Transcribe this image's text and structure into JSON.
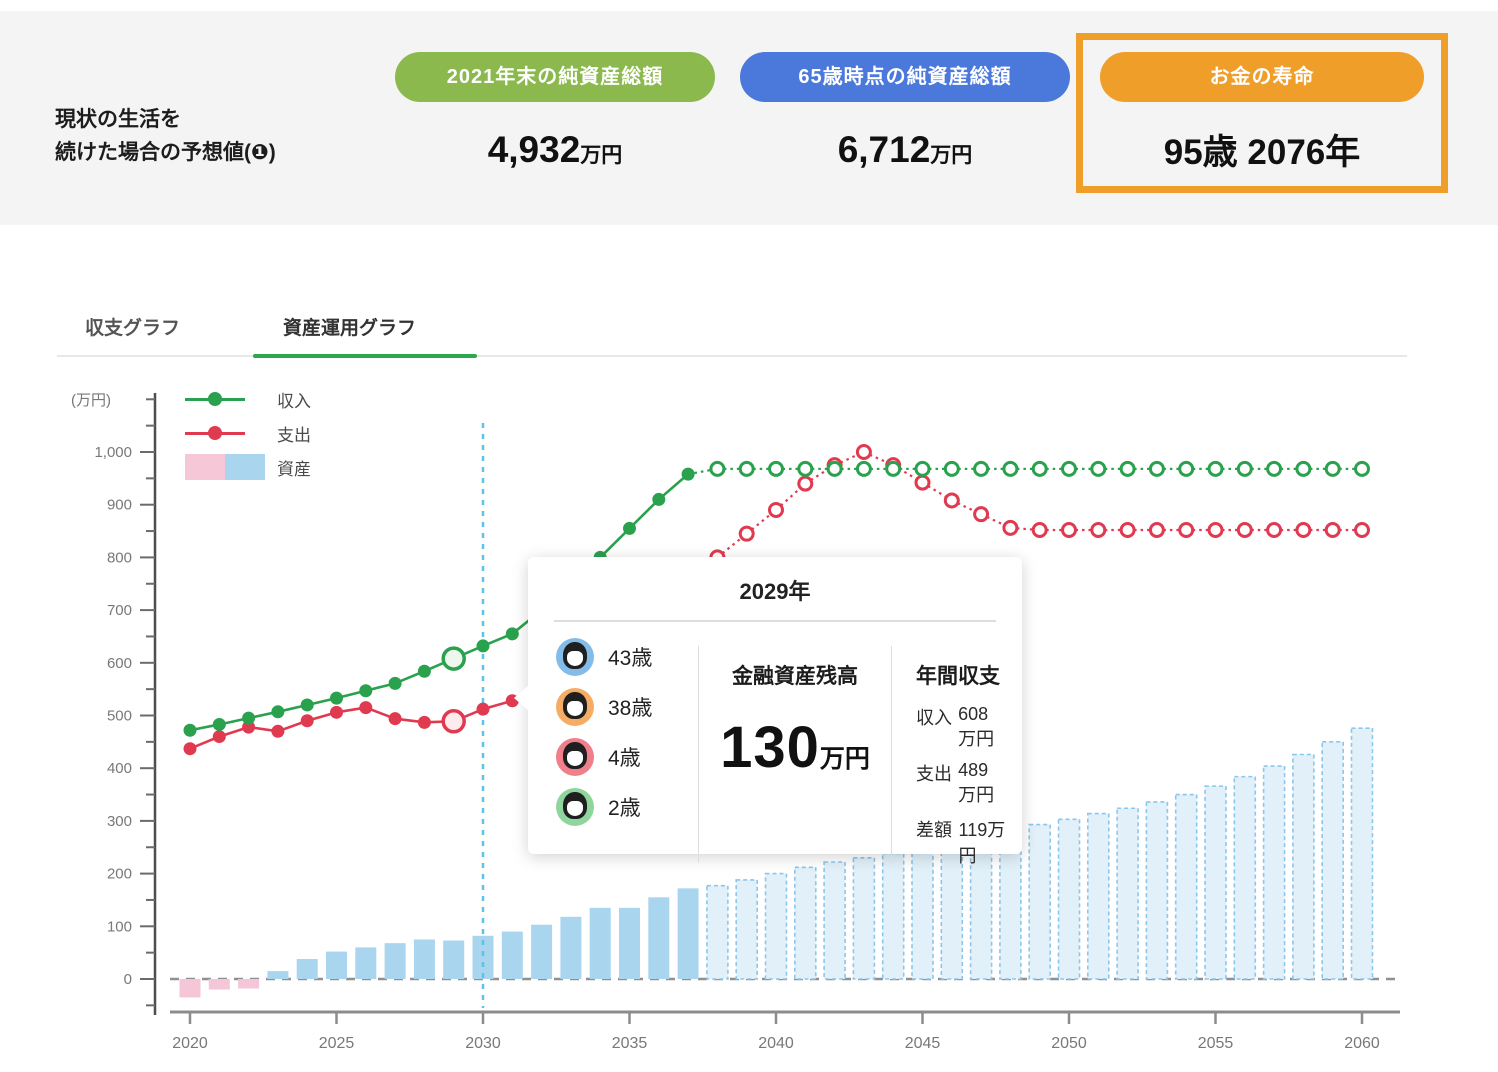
{
  "header": {
    "left_label_line1": "現状の生活を",
    "left_label_line2": "続けた場合の予想値(❶)",
    "stats": [
      {
        "badge": "2021年末の純資産総額",
        "value": "4,932",
        "unit": "万円",
        "badge_color": "#8cb94e"
      },
      {
        "badge": "65歳時点の純資産総額",
        "value": "6,712",
        "unit": "万円",
        "badge_color": "#4b78db"
      },
      {
        "badge": "お金の寿命",
        "value": "95歳 2076年",
        "unit": "",
        "badge_color": "#ef9e2a",
        "highlighted": true
      }
    ]
  },
  "tabs": [
    {
      "label": "収支グラフ",
      "active": false
    },
    {
      "label": "資産運用グラフ",
      "active": true
    }
  ],
  "chart_data": {
    "type": "mixed line+bar",
    "unit_label": "(万円)",
    "x_start": 2020,
    "x_end": 2060,
    "x_ticks": [
      2020,
      2025,
      2030,
      2035,
      2040,
      2045,
      2050,
      2055,
      2060
    ],
    "y_ticks": [
      0,
      100,
      200,
      300,
      400,
      500,
      600,
      700,
      800,
      900,
      1000
    ],
    "y_tick_labels": [
      "0",
      "100",
      "200",
      "300",
      "400",
      "500",
      "600",
      "700",
      "800",
      "900",
      "1,000"
    ],
    "ylim": [
      -100,
      1100
    ],
    "highlight_year": 2029,
    "cursor_year": 2030,
    "cursor_color": "#5ec1e8",
    "zero_line_color": "#909090",
    "series": [
      {
        "name": "収入",
        "type": "line",
        "color": "#2aa14d",
        "highlight_fill": "#edf7ee",
        "projected_from": 2038,
        "values": [
          472,
          483,
          495,
          507,
          520,
          533,
          547,
          561,
          584,
          608,
          632,
          655,
          700,
          748,
          800,
          855,
          910,
          958,
          968,
          968,
          968,
          968,
          968,
          968,
          968,
          968,
          968,
          968,
          968,
          968,
          968,
          968,
          968,
          968,
          968,
          968,
          968,
          968,
          968,
          968,
          968
        ]
      },
      {
        "name": "支出",
        "type": "line",
        "color": "#e03a50",
        "highlight_fill": "#fdebee",
        "projected_from": 2038,
        "values": [
          437,
          460,
          478,
          470,
          490,
          506,
          515,
          494,
          487,
          489,
          512,
          528,
          548,
          572,
          600,
          635,
          680,
          735,
          800,
          845,
          890,
          940,
          975,
          1000,
          975,
          942,
          908,
          882,
          856,
          852,
          852,
          852,
          852,
          852,
          852,
          852,
          852,
          852,
          852,
          852,
          852
        ]
      },
      {
        "name": "資産",
        "type": "bar",
        "color_positive": "#a9d5ef",
        "color_negative": "#f5c6d7",
        "color_projected_fill": "#e2f0fa",
        "color_projected_stroke": "#8cc6ea",
        "projected_from": 2038,
        "values": [
          -35,
          -20,
          -18,
          15,
          38,
          52,
          60,
          68,
          75,
          73,
          82,
          90,
          103,
          118,
          135,
          135,
          155,
          172,
          177,
          188,
          200,
          212,
          222,
          230,
          238,
          247,
          258,
          270,
          283,
          293,
          303,
          314,
          324,
          336,
          350,
          366,
          384,
          404,
          426,
          450,
          476
        ]
      }
    ]
  },
  "tooltip": {
    "title": "2029年",
    "people": [
      {
        "age": "43歳",
        "color": "#83bce9"
      },
      {
        "age": "38歳",
        "color": "#f5ac64"
      },
      {
        "age": "4歳",
        "color": "#f07f8c"
      },
      {
        "age": "2歳",
        "color": "#8fd59e"
      }
    ],
    "balance_label": "金融資産残高",
    "balance_value": "130",
    "balance_unit": "万円",
    "annual_label": "年間収支",
    "annual_rows": [
      {
        "label": "収入",
        "value": "608万円"
      },
      {
        "label": "支出",
        "value": "489万円"
      },
      {
        "label": "差額",
        "value": "119万円"
      }
    ]
  }
}
